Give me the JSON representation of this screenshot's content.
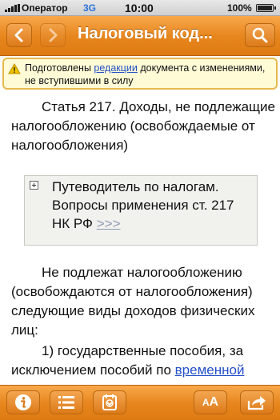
{
  "status_bar": {
    "carrier": "Оператор",
    "network": "3G",
    "time": "10:00",
    "battery": "100%"
  },
  "nav": {
    "title": "Налоговый код..."
  },
  "notice": {
    "text_before": "Подготовлены ",
    "link": "редакции",
    "text_after": " документа с изменениями, не вступившими в силу"
  },
  "article": {
    "title": "Статья 217. Доходы, не подлежащие налогообложению (освобождаемые от налогообложения)",
    "guide_text": "Путеводитель по налогам. Вопросы применения ст. 217 НК РФ",
    "guide_link": ">>>",
    "para1": "Не подлежат налогообложению (освобождаются от налогообложения) следующие виды доходов физических лиц:",
    "para2_text": "1) государственные пособия, за исключением пособий по ",
    "para2_link": "временной"
  },
  "toolbar": {
    "font_small": "A",
    "font_large": "A"
  },
  "colors": {
    "accent": "#e8871f",
    "notice_bg": "#fffbd6",
    "link": "#2350c8"
  }
}
